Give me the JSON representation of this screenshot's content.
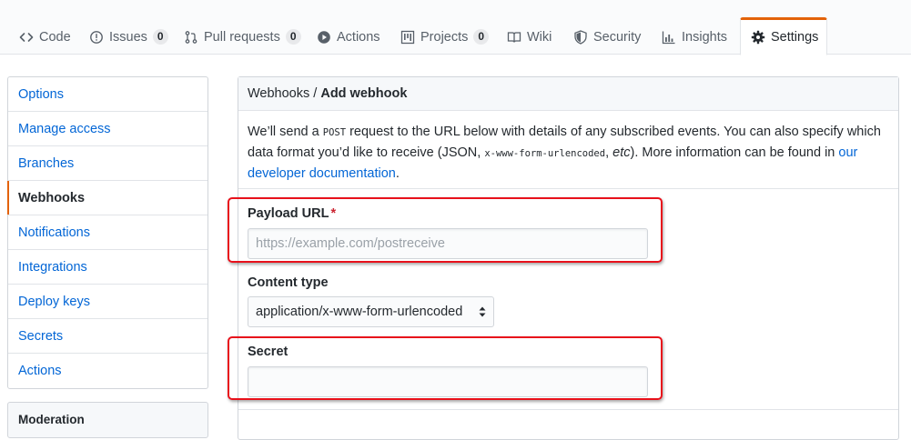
{
  "tabs": [
    {
      "label": "Code",
      "icon": "code-icon"
    },
    {
      "label": "Issues",
      "icon": "issue-icon",
      "count": "0"
    },
    {
      "label": "Pull requests",
      "icon": "pull-request-icon",
      "count": "0"
    },
    {
      "label": "Actions",
      "icon": "play-icon"
    },
    {
      "label": "Projects",
      "icon": "project-icon",
      "count": "0"
    },
    {
      "label": "Wiki",
      "icon": "book-icon"
    },
    {
      "label": "Security",
      "icon": "shield-icon"
    },
    {
      "label": "Insights",
      "icon": "graph-icon"
    },
    {
      "label": "Settings",
      "icon": "gear-icon",
      "selected": true
    }
  ],
  "sidebar": {
    "items": [
      {
        "label": "Options"
      },
      {
        "label": "Manage access"
      },
      {
        "label": "Branches"
      },
      {
        "label": "Webhooks",
        "selected": true
      },
      {
        "label": "Notifications"
      },
      {
        "label": "Integrations"
      },
      {
        "label": "Deploy keys"
      },
      {
        "label": "Secrets"
      },
      {
        "label": "Actions"
      }
    ],
    "section2_title": "Moderation"
  },
  "panel": {
    "breadcrumb_parent": "Webhooks",
    "breadcrumb_sep": " / ",
    "breadcrumb_current": "Add webhook",
    "intro": {
      "t1": "We’ll send a ",
      "m1": "POST",
      "t2": " request to the URL below with details of any subscribed events. You can also specify which data format you’d like to receive (JSON, ",
      "m2": "x-www-form-urlencoded",
      "t3": ", ",
      "em": "etc",
      "t4": "). More information can be found in ",
      "link": "our developer documentation",
      "t5": "."
    },
    "payload_label": "Payload URL",
    "required_mark": "*",
    "payload_placeholder": "https://example.com/postreceive",
    "payload_value": "",
    "content_type_label": "Content type",
    "content_type_value": "application/x-www-form-urlencoded",
    "secret_label": "Secret",
    "secret_value": ""
  },
  "colors": {
    "accent": "#e36209",
    "link": "#0366d6",
    "annotation": "#e8111b",
    "required": "#cb2431"
  }
}
